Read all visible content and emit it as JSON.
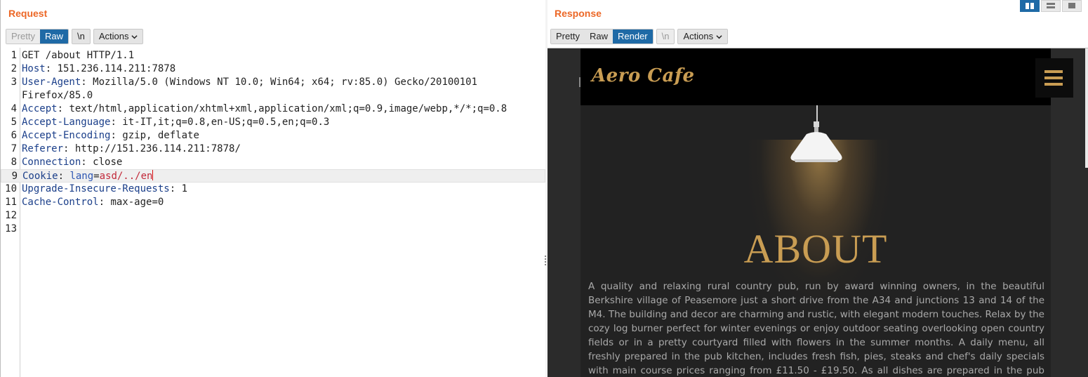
{
  "request": {
    "title": "Request",
    "buttons": {
      "pretty": "Pretty",
      "raw": "Raw",
      "newline": "\\n",
      "actions": "Actions"
    },
    "lines": [
      {
        "num": "1",
        "name": "",
        "sep": "",
        "value": "GET /about HTTP/1.1"
      },
      {
        "num": "2",
        "name": "Host",
        "sep": ": ",
        "value": "151.236.114.211:7878"
      },
      {
        "num": "3",
        "name": "User-Agent",
        "sep": ": ",
        "value": "Mozilla/5.0 (Windows NT 10.0; Win64; x64; rv:85.0) Gecko/20100101"
      },
      {
        "num": "",
        "name": "",
        "sep": "",
        "value": "Firefox/85.0"
      },
      {
        "num": "4",
        "name": "Accept",
        "sep": ": ",
        "value": "text/html,application/xhtml+xml,application/xml;q=0.9,image/webp,*/*;q=0.8"
      },
      {
        "num": "5",
        "name": "Accept-Language",
        "sep": ": ",
        "value": "it-IT,it;q=0.8,en-US;q=0.5,en;q=0.3"
      },
      {
        "num": "6",
        "name": "Accept-Encoding",
        "sep": ": ",
        "value": "gzip, deflate"
      },
      {
        "num": "7",
        "name": "Referer",
        "sep": ": ",
        "value": "http://151.236.114.211:7878/"
      },
      {
        "num": "8",
        "name": "Connection",
        "sep": ": ",
        "value": "close"
      },
      {
        "num": "9",
        "name": "Cookie",
        "sep": ": ",
        "cookie_name": "lang",
        "cookie_eq": "=",
        "cookie_value": "asd/../en"
      },
      {
        "num": "10",
        "name": "Upgrade-Insecure-Requests",
        "sep": ": ",
        "value": "1"
      },
      {
        "num": "11",
        "name": "Cache-Control",
        "sep": ": ",
        "value": "max-age=0"
      },
      {
        "num": "12",
        "name": "",
        "sep": "",
        "value": ""
      },
      {
        "num": "13",
        "name": "",
        "sep": "",
        "value": ""
      }
    ]
  },
  "response": {
    "title": "Response",
    "buttons": {
      "pretty": "Pretty",
      "raw": "Raw",
      "render": "Render",
      "newline": "\\n",
      "actions": "Actions"
    },
    "page": {
      "brand": "Aero Cafe",
      "heading": "ABOUT",
      "body": "A quality and relaxing rural country pub, run by award winning owners, in the beautiful Berkshire village of Peasemore just a short drive from the A34 and junctions 13 and 14 of the M4. The building and decor are charming and rustic, with elegant modern touches. Relax by the cozy log burner perfect for winter evenings or enjoy outdoor seating overlooking open country fields or in a pretty courtyard filled with flowers in the summer months. A daily menu, all freshly prepared in the pub kitchen, includes fresh fish, pies, steaks and chef's daily specials with main course prices ranging from £11.50 - £19.50. As all dishes are prepared in the pub kitchen, they are able to cater"
    }
  },
  "colors": {
    "accent": "#ec6726",
    "active": "#1f6aa6",
    "gold": "#c99d53"
  }
}
